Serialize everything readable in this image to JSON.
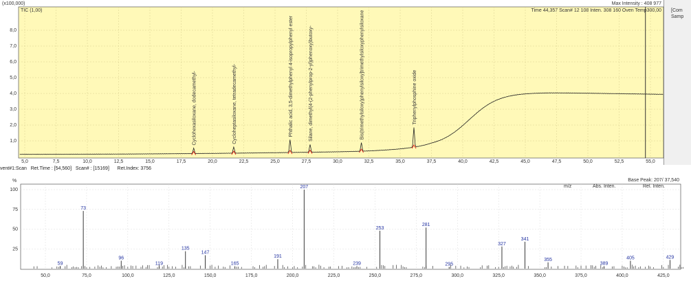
{
  "tic": {
    "scale_label": "(x100,000)",
    "title": "TIC (1,00)",
    "max_intensity": "Max Intensity : 408 977",
    "status": "Time  44,357   Scan# 12 108   Inten.          308 160   Oven Temp300,00",
    "y_ticks": [
      "1,0",
      "2,0",
      "3,0",
      "4,0",
      "5,0",
      "6,0",
      "7,0",
      "8,0"
    ],
    "x_ticks": [
      "5,0",
      "7,5",
      "10,0",
      "12,5",
      "15,0",
      "17,5",
      "20,0",
      "22,5",
      "25,0",
      "27,5",
      "30,0",
      "32,5",
      "35,0",
      "37,5",
      "40,0",
      "42,5",
      "45,0",
      "47,5",
      "50,0",
      "52,5",
      "55,0"
    ],
    "peaks": [
      {
        "rt": 18.5,
        "h": 0.35,
        "label": "Cyclohexasiloxane, dodecamethyl-"
      },
      {
        "rt": 21.7,
        "h": 0.4,
        "label": "Cycloheptasiloxane, tetradecamethyl-"
      },
      {
        "rt": 26.2,
        "h": 0.8,
        "label": "Phthalic acid, 3,5-dimethylphenyl 4-isopropylphenyl ester"
      },
      {
        "rt": 27.8,
        "h": 0.5,
        "label": "Silane, dimethyl(4-(2-phenylprop-2-yl)phenoxy)butoxy-"
      },
      {
        "rt": 31.9,
        "h": 0.55,
        "label": "Bis(trimethylsiloxy)phenylsiloxy]trimethylsiloxyphenylsiloxane"
      },
      {
        "rt": 36.1,
        "h": 1.25,
        "label": "Triphenylphosphine oxide"
      }
    ],
    "cursor_rt": 54.6,
    "side": [
      "[Com",
      "Samp"
    ]
  },
  "scan": {
    "info": "vent#1:Scan   Ret.Time : [54,560]   Scan# : [15169]      Ret.Index: 3756"
  },
  "ms": {
    "y_label": "%",
    "base_peak": "Base Peak: 207/ 37,540",
    "cols": [
      "m/z",
      "Abs. Inten.",
      "Rel. Inten."
    ],
    "y_ticks": [
      "25",
      "50",
      "75",
      "100"
    ],
    "x_ticks": [
      "50,0",
      "75,0",
      "100,0",
      "125,0",
      "150,0",
      "175,0",
      "200,0",
      "225,0",
      "250,0",
      "275,0",
      "300,0",
      "325,0",
      "350,0",
      "375,0",
      "400,0",
      "425,0"
    ],
    "peaks": [
      [
        59,
        3,
        "59"
      ],
      [
        73,
        73,
        "73"
      ],
      [
        96,
        10,
        "96"
      ],
      [
        119,
        3,
        "119"
      ],
      [
        135,
        22,
        "135"
      ],
      [
        147,
        17,
        "147"
      ],
      [
        165,
        3,
        "165"
      ],
      [
        191,
        12,
        "191"
      ],
      [
        207,
        100,
        "207"
      ],
      [
        239,
        3,
        "239"
      ],
      [
        253,
        48,
        "253"
      ],
      [
        281,
        52,
        "281"
      ],
      [
        295,
        2,
        "295"
      ],
      [
        327,
        28,
        "327"
      ],
      [
        341,
        34,
        "341"
      ],
      [
        355,
        8,
        "355"
      ],
      [
        389,
        3,
        "389"
      ],
      [
        405,
        10,
        "405"
      ],
      [
        429,
        11,
        "429"
      ]
    ]
  }
}
